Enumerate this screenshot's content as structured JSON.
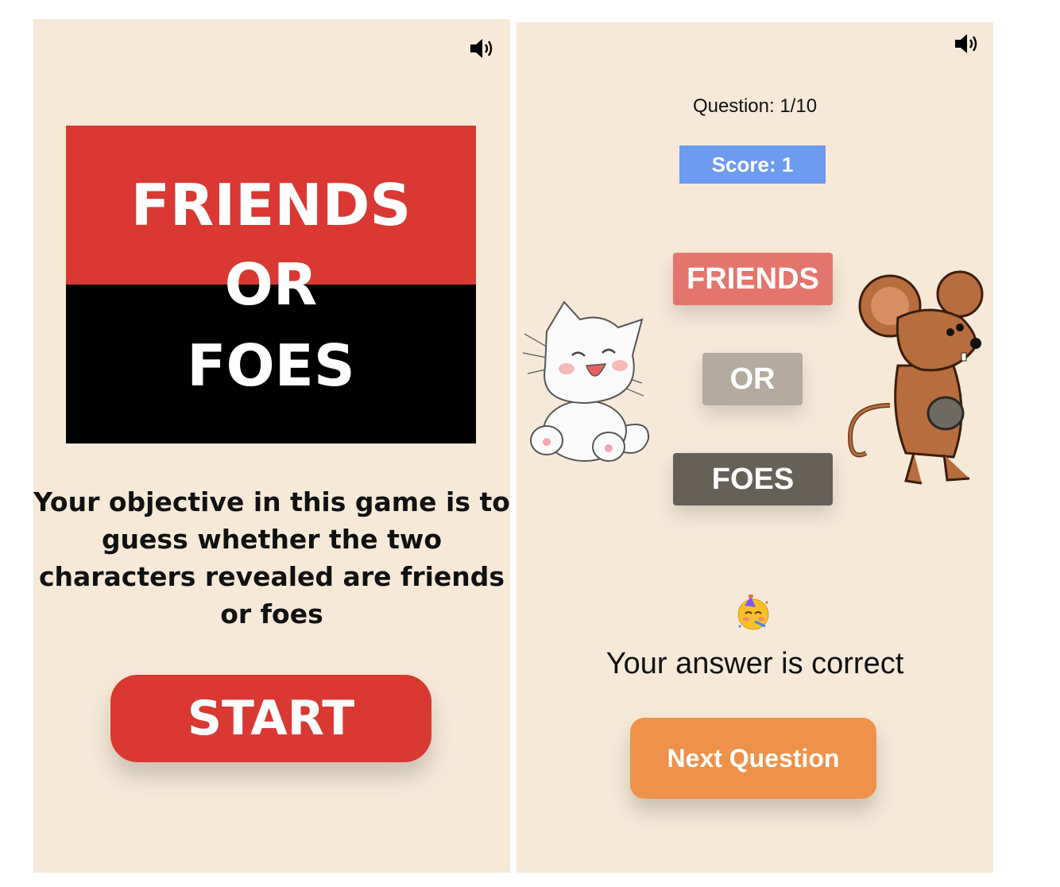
{
  "start_screen": {
    "logo": {
      "line1": "FRIENDS",
      "line2": "OR",
      "line3": "FOES"
    },
    "objective": "Your objective in this game is to guess whether the two characters revealed are friends or foes",
    "start_label": "START",
    "sound_icon": "speaker-volume-icon"
  },
  "question_screen": {
    "question_label": "Question: 1/10",
    "score_label": "Score: 1",
    "options": [
      "FRIENDS",
      "OR",
      "FOES"
    ],
    "feedback_emoji": "partying-face-icon",
    "result_text": "Your answer is correct",
    "next_label": "Next Question",
    "left_character": "white-kitten-icon",
    "right_character": "brown-mouse-icon",
    "sound_icon": "speaker-volume-icon"
  },
  "colors": {
    "background": "#f6e9d8",
    "brand_red": "#da3833",
    "score_blue": "#6c9bf0",
    "friends": "#e4756c",
    "or": "#b4aa9d",
    "foes": "#656058",
    "next": "#ee914a"
  }
}
